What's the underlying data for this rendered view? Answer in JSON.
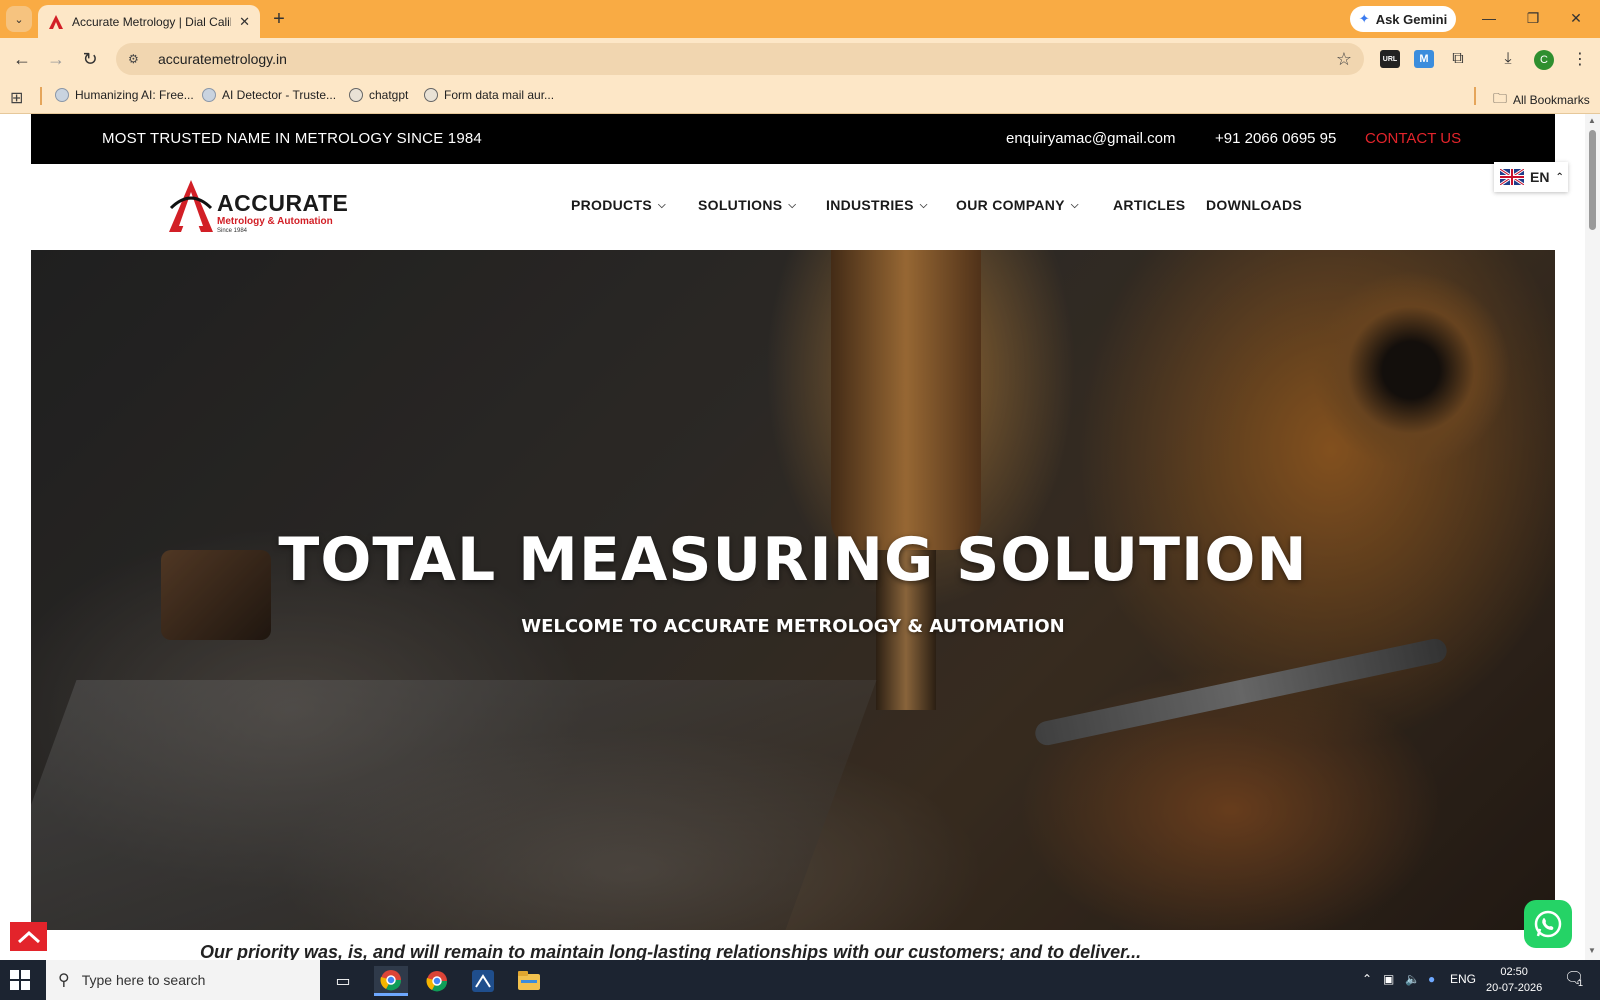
{
  "browser": {
    "tab_title": "Accurate Metrology | Dial Calibr",
    "tab_close": "✕",
    "new_tab": "+",
    "gemini_label": "Ask Gemini",
    "url": "accuratemetrology.in",
    "extension_labels": {
      "url": "URL",
      "m": "M"
    },
    "profile_initial": "C",
    "bookmarks": [
      {
        "label": "Humanizing AI: Free..."
      },
      {
        "label": "AI Detector - Truste..."
      },
      {
        "label": "chatgpt"
      },
      {
        "label": "Form data mail aur..."
      }
    ],
    "all_bookmarks": "All Bookmarks"
  },
  "site": {
    "topbar": {
      "tagline": "MOST TRUSTED NAME IN METROLOGY SINCE 1984",
      "email": "enquiryamac@gmail.com",
      "phone": "+91 2066 0695 95",
      "contact": "CONTACT US"
    },
    "logo": {
      "word": "ACCURATE",
      "sub": "Metrology & Automation",
      "since": "Since 1984"
    },
    "nav": [
      {
        "label": "PRODUCTS"
      },
      {
        "label": "SOLUTIONS"
      },
      {
        "label": "INDUSTRIES"
      },
      {
        "label": "OUR COMPANY"
      },
      {
        "label": "ARTICLES"
      },
      {
        "label": "DOWNLOADS"
      }
    ],
    "language": "EN",
    "hero": {
      "title": "TOTAL MEASURING SOLUTION",
      "subtitle": "WELCOME TO ACCURATE METROLOGY & AUTOMATION"
    },
    "below_text": "Our priority was, is, and will remain to maintain long-lasting relationships with our customers; and to deliver..."
  },
  "taskbar": {
    "search_placeholder": "Type here to search",
    "language": "ENG",
    "time": "02:50",
    "date": "20-07-2026",
    "notification_count": "1"
  },
  "colors": {
    "tabbar": "#f9ab44",
    "chrome_light": "#fde7c7",
    "brand_red": "#e3242b",
    "topstrip": "#000000"
  }
}
